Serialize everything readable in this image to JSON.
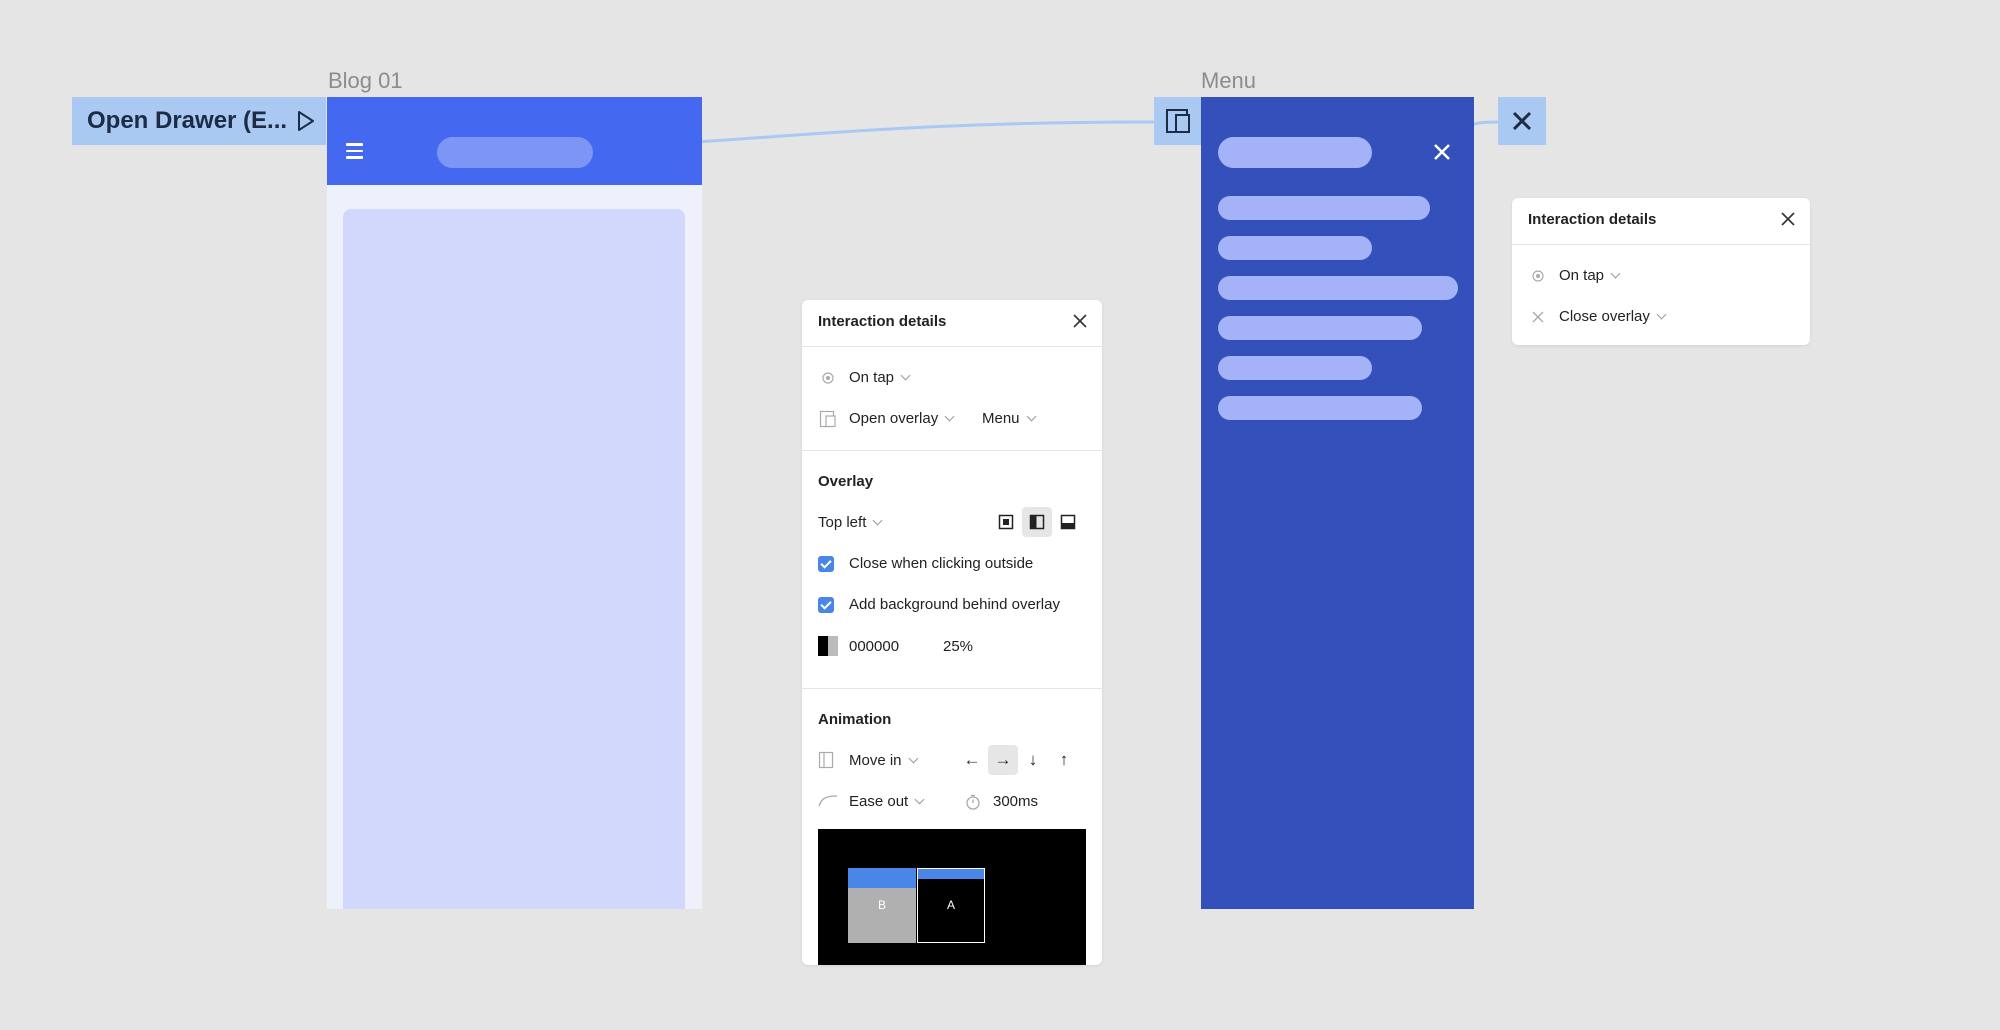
{
  "frames": {
    "blog": {
      "label": "Blog 01"
    },
    "menu": {
      "label": "Menu"
    }
  },
  "flow_start": {
    "label": "Open Drawer (E...",
    "icon": "play-icon"
  },
  "colors": {
    "canvas": "#e5e5e5",
    "blog_header": "#4468f0",
    "blog_card": "#d1d8fb",
    "menu_bg": "#3450ba",
    "menu_bars": "#a4b3f8",
    "connector": "#a9c9f3",
    "checkbox": "#4a86e8"
  },
  "interaction_panel": {
    "title": "Interaction details",
    "trigger": {
      "icon": "tap-icon",
      "label": "On tap"
    },
    "action": {
      "icon": "open-overlay-icon",
      "label": "Open overlay",
      "destination": "Menu"
    },
    "overlay": {
      "title": "Overlay",
      "position": "Top left",
      "position_options": [
        "center-position-icon",
        "left-position-icon",
        "bottom-position-icon"
      ],
      "selected_position_option": "left-position-icon",
      "close_outside": {
        "label": "Close when clicking outside",
        "checked": true
      },
      "add_background": {
        "label": "Add background behind overlay",
        "checked": true
      },
      "background_color": "000000",
      "background_opacity": "25%"
    },
    "animation": {
      "title": "Animation",
      "type": "Move in",
      "directions": [
        "←",
        "→",
        "↓",
        "↑"
      ],
      "selected_direction": "→",
      "easing": "Ease out",
      "duration": "300ms",
      "preview": {
        "frame_b": "B",
        "frame_a": "A"
      }
    }
  },
  "close_panel": {
    "title": "Interaction details",
    "trigger": {
      "icon": "tap-icon",
      "label": "On tap"
    },
    "action": {
      "icon": "close-icon",
      "label": "Close overlay"
    }
  }
}
